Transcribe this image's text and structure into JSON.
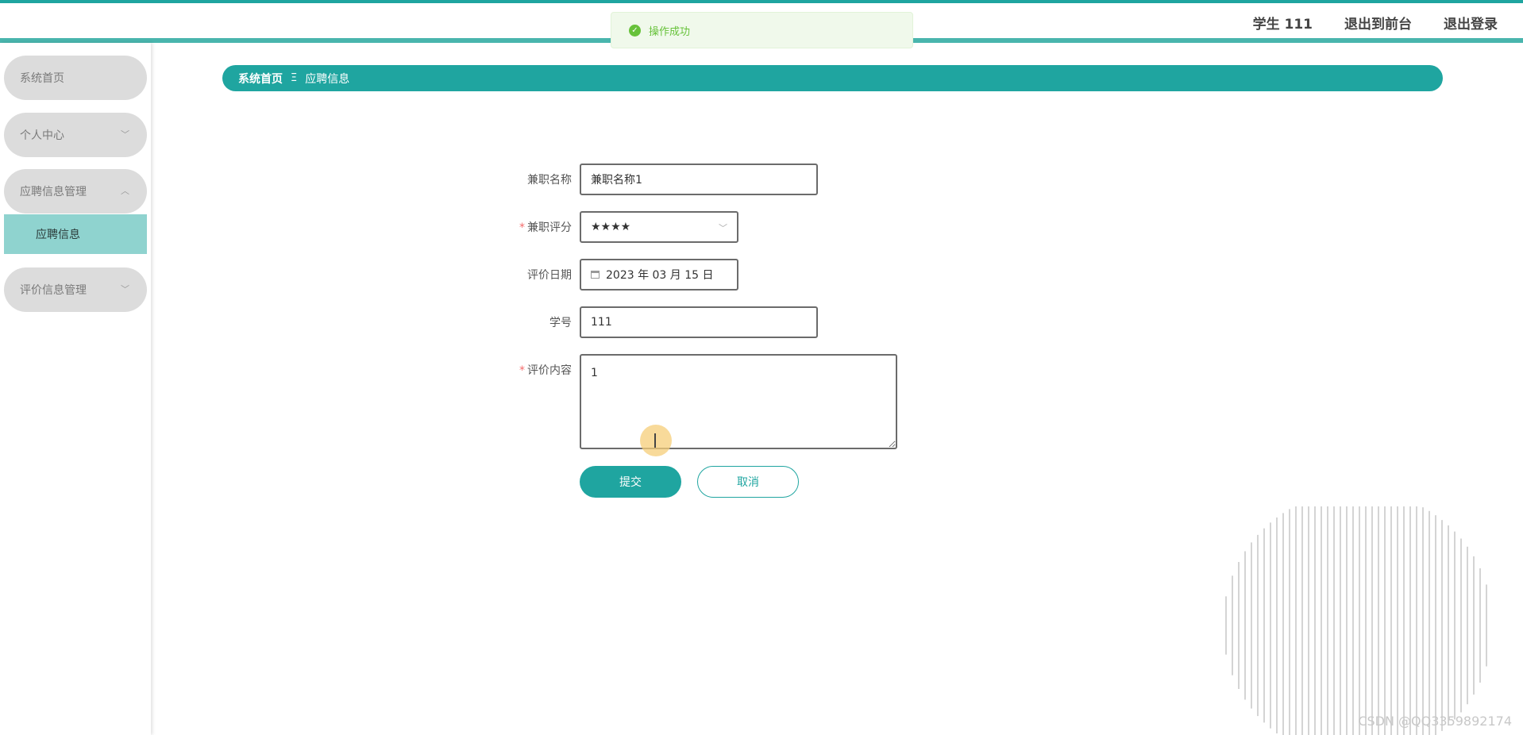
{
  "header": {
    "user_label": "学生 111",
    "to_frontend": "退出到前台",
    "logout": "退出登录"
  },
  "toast": {
    "message": "操作成功",
    "icon": "check-circle-icon",
    "color": "#67c23a"
  },
  "sidebar": {
    "items": [
      {
        "label": "系统首页"
      },
      {
        "label": "个人中心",
        "chevron": "﹀"
      },
      {
        "label": "应聘信息管理",
        "chevron": "︿"
      },
      {
        "label": "评价信息管理",
        "chevron": "﹀"
      }
    ],
    "sub_item": "应聘信息"
  },
  "breadcrumb": {
    "home": "系统首页",
    "separator": "Ξ",
    "current": "应聘信息"
  },
  "form": {
    "job_name_label": "兼职名称",
    "job_name_value": "兼职名称1",
    "rating_label": "兼职评分",
    "rating_value": "★★★★",
    "date_label": "评价日期",
    "date_value": "2023 年 03 月 15 日",
    "student_no_label": "学号",
    "student_no_value": "111",
    "content_label": "评价内容",
    "content_value": "1",
    "required_mark": "*",
    "submit": "提交",
    "cancel": "取消"
  },
  "watermark": "CSDN @QQ3359892174",
  "colors": {
    "accent": "#1fa5a0",
    "sidebar_active": "#8fd3cf",
    "sidebar_item": "#dcdcdc"
  }
}
